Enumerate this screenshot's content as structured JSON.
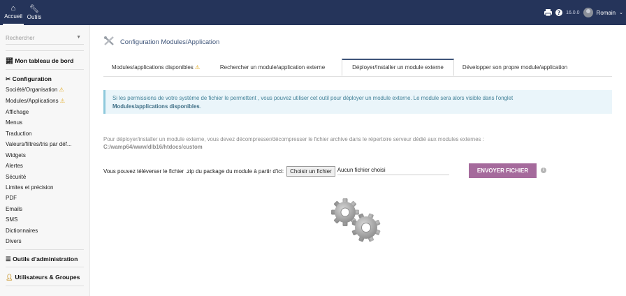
{
  "topbar": {
    "nav": [
      {
        "label": "Accueil",
        "icon": "home-icon"
      },
      {
        "label": "Outils",
        "icon": "wrench-icon"
      }
    ],
    "version": "16.0.0",
    "user": "Romain"
  },
  "sidebar": {
    "search_placeholder": "Rechercher",
    "dashboard_label": "Mon tableau de bord",
    "config_label": "Configuration",
    "items": [
      "Société/Organisation",
      "Modules/Applications",
      "Affichage",
      "Menus",
      "Traduction",
      "Valeurs/filtres/tris par déf...",
      "Widgets",
      "Alertes",
      "Sécurité",
      "Limites et précision",
      "PDF",
      "Emails",
      "SMS",
      "Dictionnaires",
      "Divers"
    ],
    "admin_tools_label": "Outils d'administration",
    "users_groups_label": "Utilisateurs & Groupes"
  },
  "page": {
    "title": "Configuration Modules/Application",
    "tabs": [
      "Modules/applications disponibles",
      "Rechercher un module/application externe",
      "Déployer/Installer un module externe",
      "Développer son propre module/application"
    ],
    "info_line1": "Si les permissions de votre système de fichier le permettent , vous pouvez utiliser cet outil pour déployer un module externe. Le module sera alors visible dans l'onglet",
    "info_line2": "Modules/applications disponibles",
    "info_line2_suffix": ".",
    "deploy_text": "Pour déployer/installer un module externe, vous devez décompresser/décompresser le fichier archive dans le répertoire serveur dédié aux modules externes :",
    "deploy_path": "C:/wamp64/www/dlb16/htdocs/custom",
    "upload_label": "Vous pouvez téléverser le fichier .zip du package du module à partir d'ici:",
    "choose_file_label": "Choisir un fichier",
    "no_file_label": "Aucun fichier choisi",
    "send_button_label": "ENVOYER FICHIER"
  },
  "colors": {
    "topbar": "#25345a",
    "accent": "#3e5479",
    "warning": "#e0a61a",
    "send_button": "#a56a9c",
    "info_bg": "#eaf5fa"
  }
}
